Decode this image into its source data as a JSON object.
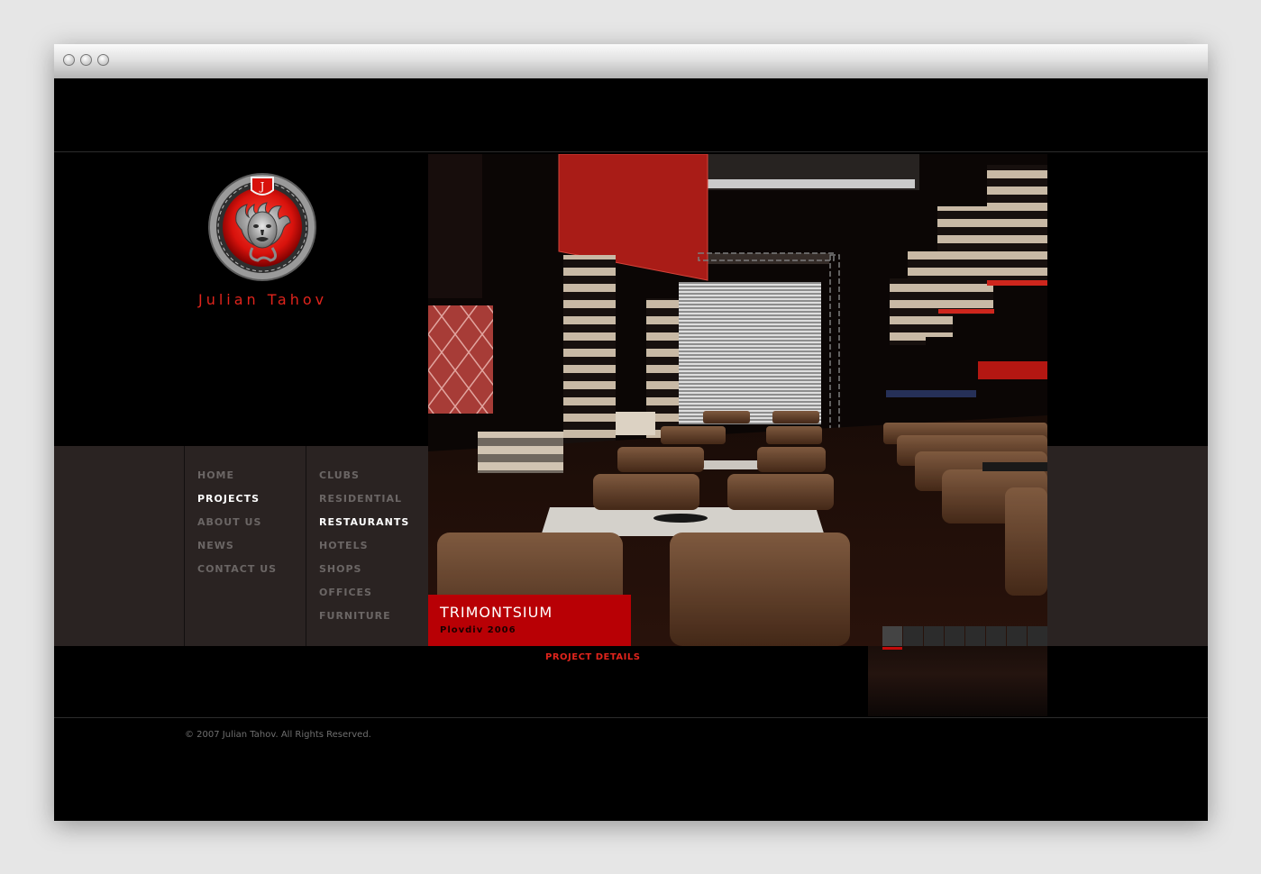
{
  "site": {
    "brand_name": "Julian Tahov",
    "copyright": "© 2007 Julian Tahov. All Rights Reserved."
  },
  "main_nav": [
    {
      "label": "HOME",
      "active": false
    },
    {
      "label": "PROJECTS",
      "active": true
    },
    {
      "label": "ABOUT US",
      "active": false
    },
    {
      "label": "NEWS",
      "active": false
    },
    {
      "label": "CONTACT US",
      "active": false
    }
  ],
  "sub_nav": [
    {
      "label": "CLUBS",
      "active": false
    },
    {
      "label": "RESIDENTIAL",
      "active": false
    },
    {
      "label": "RESTAURANTS",
      "active": true
    },
    {
      "label": "HOTELS",
      "active": false
    },
    {
      "label": "SHOPS",
      "active": false
    },
    {
      "label": "OFFICES",
      "active": false
    },
    {
      "label": "FURNITURE",
      "active": false
    }
  ],
  "project": {
    "title": "TRIMONTSIUM",
    "subtitle": "Plovdiv 2006",
    "details_link": "PROJECT DETAILS"
  },
  "gallery": {
    "thumbnail_count": 8,
    "active_index": 0
  },
  "colors": {
    "accent_red": "#e0241c",
    "caption_red": "#b80005",
    "nav_band": "#2a2322",
    "nav_inactive": "#6b6665",
    "nav_active": "#ffffff",
    "background": "#000000"
  },
  "icons": {
    "logo": "medusa-emblem-icon",
    "window_buttons": [
      "close-button-icon",
      "minimize-button-icon",
      "zoom-button-icon"
    ]
  }
}
